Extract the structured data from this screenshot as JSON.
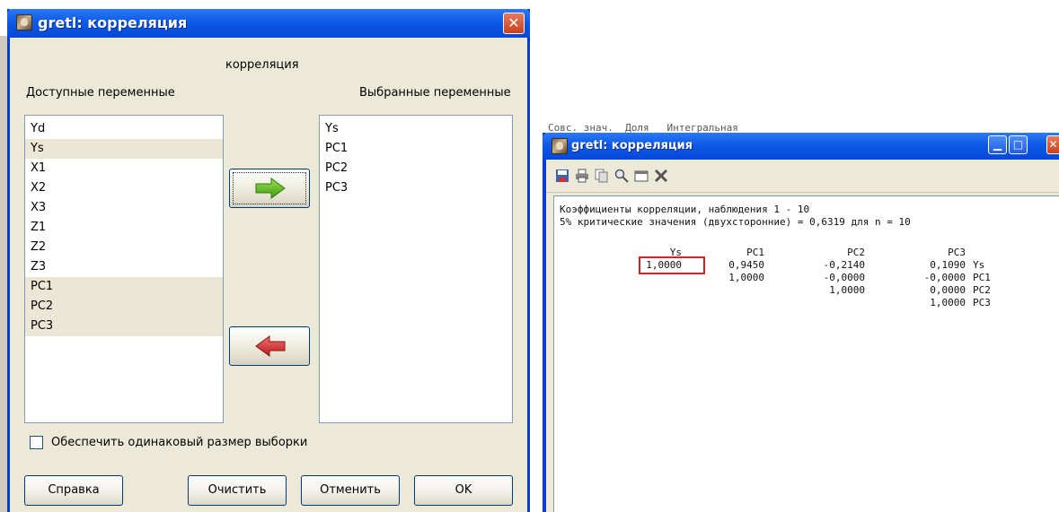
{
  "dialog": {
    "title": "gretl: корреляция",
    "close_glyph": "✕",
    "heading": "корреляция",
    "available_label": "Доступные переменные",
    "selected_label": "Выбранные переменные",
    "available_items": [
      "Yd",
      "Ys",
      "X1",
      "X2",
      "X3",
      "Z1",
      "Z2",
      "Z3",
      "PC1",
      "PC2",
      "PC3"
    ],
    "selected_items": [
      "Ys",
      "PC1",
      "PC2",
      "PC3"
    ],
    "add_icon": "green-right-arrow-icon",
    "remove_icon": "red-left-arrow-icon",
    "checkbox_label": "Обеспечить одинаковый размер выборки",
    "checkbox_checked": false,
    "buttons": {
      "help": "Справка",
      "clear": "Очистить",
      "cancel": "Отменить",
      "ok": "OK"
    }
  },
  "background_text": "Совс. знач.  Доля   Интегральная",
  "output_window": {
    "title": "gretl: корреляция",
    "toolbar_icons": [
      "save-icon",
      "print-icon",
      "copy-icon",
      "find-icon",
      "window-icon",
      "close-icon"
    ],
    "line1": "Коэффициенты корреляции, наблюдения 1 - 10",
    "line2": "5% критические значения (двухсторонние) = 0,6319 для n = 10",
    "columns": [
      "Ys",
      "PC1",
      "PC2",
      "PC3"
    ],
    "rows": [
      {
        "label": "Ys",
        "values": [
          "1,0000",
          "0,9450",
          "-0,2140",
          "0,1090"
        ]
      },
      {
        "label": "PC1",
        "values": [
          "",
          "1,0000",
          "-0,0000",
          "-0,0000"
        ]
      },
      {
        "label": "PC2",
        "values": [
          "",
          "",
          "1,0000",
          "0,0000"
        ]
      },
      {
        "label": "PC3",
        "values": [
          "",
          "",
          "",
          "1,0000"
        ]
      }
    ],
    "highlight_color": "#e02020"
  }
}
